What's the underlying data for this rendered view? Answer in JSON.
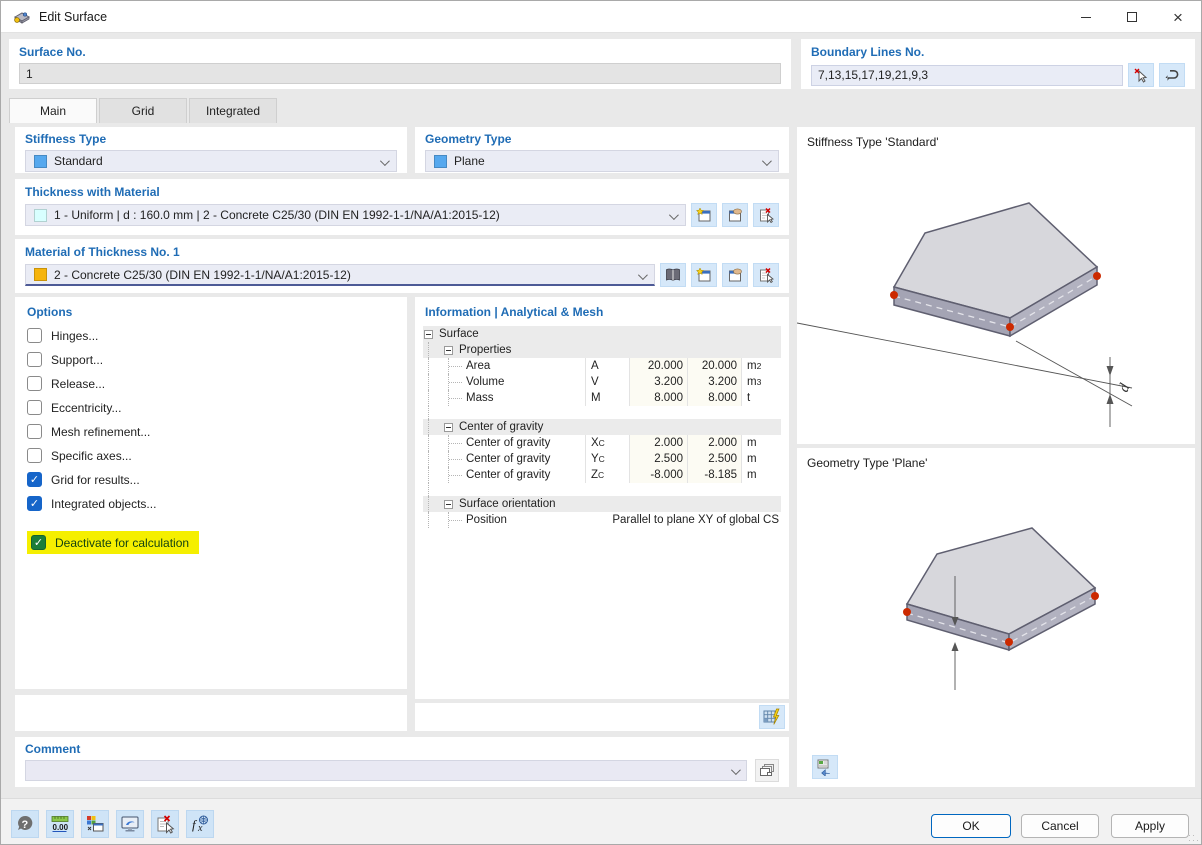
{
  "window": {
    "title": "Edit Surface"
  },
  "surface_no": {
    "label": "Surface No.",
    "value": "1"
  },
  "boundary_lines": {
    "label": "Boundary Lines No.",
    "value": "7,13,15,17,19,21,9,3"
  },
  "tabs": [
    {
      "label": "Main",
      "active": true
    },
    {
      "label": "Grid",
      "active": false
    },
    {
      "label": "Integrated",
      "active": false
    }
  ],
  "stiffness_type": {
    "label": "Stiffness Type",
    "value": "Standard"
  },
  "geometry_type": {
    "label": "Geometry Type",
    "value": "Plane"
  },
  "thickness": {
    "label": "Thickness with Material",
    "value": "1 - Uniform | d : 160.0 mm | 2 - Concrete C25/30 (DIN EN 1992-1-1/NA/A1:2015-12)"
  },
  "material": {
    "label": "Material of Thickness No. 1",
    "value": "2 - Concrete C25/30 (DIN EN 1992-1-1/NA/A1:2015-12)"
  },
  "options": {
    "label": "Options",
    "items": [
      {
        "label": "Hinges...",
        "checked": false
      },
      {
        "label": "Support...",
        "checked": false
      },
      {
        "label": "Release...",
        "checked": false
      },
      {
        "label": "Eccentricity...",
        "checked": false
      },
      {
        "label": "Mesh refinement...",
        "checked": false
      },
      {
        "label": "Specific axes...",
        "checked": false
      },
      {
        "label": "Grid for results...",
        "checked": true
      },
      {
        "label": "Integrated objects...",
        "checked": true
      },
      {
        "label": "Deactivate for calculation",
        "checked": true,
        "style": "highlight"
      }
    ]
  },
  "information": {
    "header": "Information | Analytical & Mesh",
    "tree": [
      {
        "type": "root",
        "label": "Surface"
      },
      {
        "type": "group",
        "label": "Properties"
      },
      {
        "type": "row",
        "label": "Area",
        "sym": "A",
        "v1": "20.000",
        "v2": "20.000",
        "unit": "m",
        "unit_sup": "2"
      },
      {
        "type": "row",
        "label": "Volume",
        "sym": "V",
        "v1": "3.200",
        "v2": "3.200",
        "unit": "m",
        "unit_sup": "3"
      },
      {
        "type": "row",
        "label": "Mass",
        "sym": "M",
        "v1": "8.000",
        "v2": "8.000",
        "unit": "t"
      },
      {
        "type": "gap"
      },
      {
        "type": "group",
        "label": "Center of gravity"
      },
      {
        "type": "row",
        "label": "Center of gravity",
        "sym": "X",
        "sym_sub": "C",
        "v1": "2.000",
        "v2": "2.000",
        "unit": "m"
      },
      {
        "type": "row",
        "label": "Center of gravity",
        "sym": "Y",
        "sym_sub": "C",
        "v1": "2.500",
        "v2": "2.500",
        "unit": "m"
      },
      {
        "type": "row",
        "label": "Center of gravity",
        "sym": "Z",
        "sym_sub": "C",
        "v1": "-8.000",
        "v2": "-8.185",
        "unit": "m"
      },
      {
        "type": "gap"
      },
      {
        "type": "group",
        "label": "Surface orientation"
      },
      {
        "type": "wide",
        "label": "Position",
        "value": "Parallel to plane XY of global CS"
      }
    ]
  },
  "previews": {
    "stiffness_title": "Stiffness Type 'Standard'",
    "geometry_title": "Geometry Type 'Plane'",
    "dim_label": "d"
  },
  "comment": {
    "label": "Comment",
    "value": ""
  },
  "footer": {
    "ok": "OK",
    "cancel": "Cancel",
    "apply": "Apply"
  },
  "colors": {
    "label_blue": "#1f6cb5",
    "checkbox_blue": "#1665c9",
    "checkbox_green": "#1b7d3a",
    "highlight_yellow": "#f5ef00",
    "swatch_blue": "#56a8ee",
    "swatch_cyan": "#d8ffff",
    "swatch_orange": "#f6b40c",
    "slab_top": "#d7d7dc",
    "slab_side": "#a4a4b4",
    "node_red": "#cc2a00",
    "ok_border": "#0067c0"
  }
}
